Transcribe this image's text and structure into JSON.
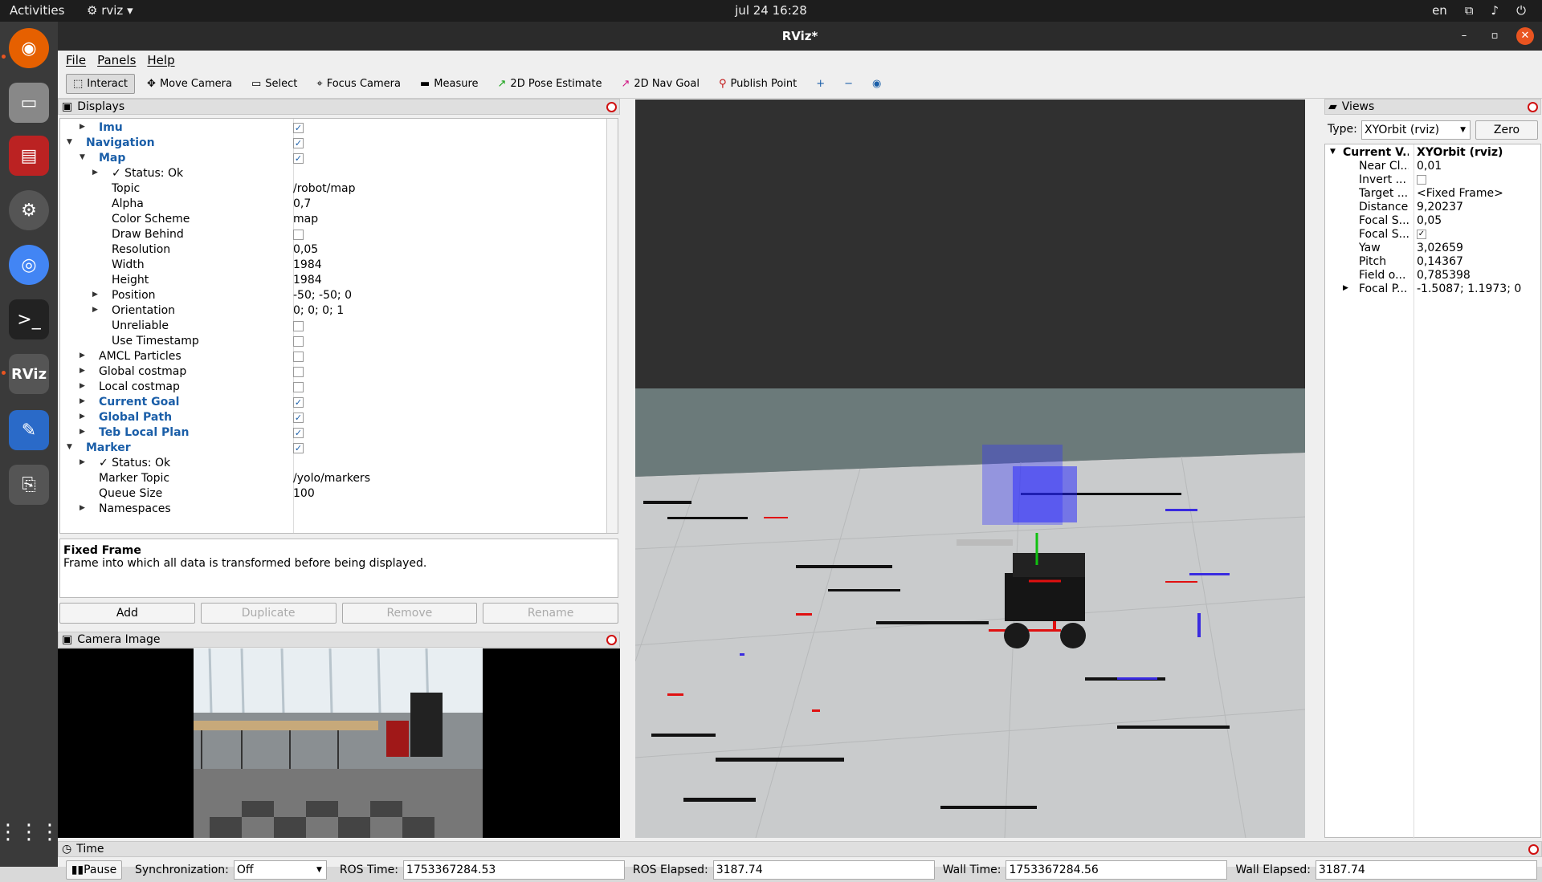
{
  "topbar": {
    "activities": "Activities",
    "app": "rviz",
    "clock": "jul 24  16:28",
    "lang": "en"
  },
  "window": {
    "title": "RViz*"
  },
  "menu": [
    "File",
    "Panels",
    "Help"
  ],
  "toolbar": [
    {
      "label": "Interact",
      "icon": "cursor-icon",
      "active": true
    },
    {
      "label": "Move Camera",
      "icon": "move-icon",
      "active": false
    },
    {
      "label": "Select",
      "icon": "select-icon",
      "active": false
    },
    {
      "label": "Focus Camera",
      "icon": "focus-icon",
      "active": false
    },
    {
      "label": "Measure",
      "icon": "ruler-icon",
      "active": false
    },
    {
      "label": "2D Pose Estimate",
      "icon": "green-arrow-icon",
      "active": false
    },
    {
      "label": "2D Nav Goal",
      "icon": "pink-arrow-icon",
      "active": false
    },
    {
      "label": "Publish Point",
      "icon": "pin-icon",
      "active": false
    }
  ],
  "displays": {
    "title": "Displays",
    "rows": [
      {
        "name": "Imu",
        "indent": 1,
        "arrow": "right",
        "blue": true,
        "check": true
      },
      {
        "name": "Navigation",
        "indent": 0,
        "arrow": "down",
        "blue": true,
        "check": true
      },
      {
        "name": "Map",
        "indent": 1,
        "arrow": "down",
        "blue": true,
        "check": true
      },
      {
        "name": "✓ Status: Ok",
        "indent": 2,
        "arrow": "right"
      },
      {
        "name": "Topic",
        "indent": 2,
        "value": "/robot/map"
      },
      {
        "name": "Alpha",
        "indent": 2,
        "value": "0,7"
      },
      {
        "name": "Color Scheme",
        "indent": 2,
        "value": "map"
      },
      {
        "name": "Draw Behind",
        "indent": 2,
        "check": false
      },
      {
        "name": "Resolution",
        "indent": 2,
        "value": "0,05"
      },
      {
        "name": "Width",
        "indent": 2,
        "value": "1984"
      },
      {
        "name": "Height",
        "indent": 2,
        "value": "1984"
      },
      {
        "name": "Position",
        "indent": 2,
        "arrow": "right",
        "value": "-50; -50; 0"
      },
      {
        "name": "Orientation",
        "indent": 2,
        "arrow": "right",
        "value": "0; 0; 0; 1"
      },
      {
        "name": "Unreliable",
        "indent": 2,
        "check": false
      },
      {
        "name": "Use Timestamp",
        "indent": 2,
        "check": false
      },
      {
        "name": "AMCL Particles",
        "indent": 1,
        "arrow": "right",
        "check": false
      },
      {
        "name": "Global costmap",
        "indent": 1,
        "arrow": "right",
        "check": false
      },
      {
        "name": "Local costmap",
        "indent": 1,
        "arrow": "right",
        "check": false
      },
      {
        "name": "Current Goal",
        "indent": 1,
        "arrow": "right",
        "blue": true,
        "check": true
      },
      {
        "name": "Global Path",
        "indent": 1,
        "arrow": "right",
        "blue": true,
        "check": true
      },
      {
        "name": "Teb Local Plan",
        "indent": 1,
        "arrow": "right",
        "blue": true,
        "check": true
      },
      {
        "name": "Marker",
        "indent": 0,
        "arrow": "down",
        "blue": true,
        "check": true
      },
      {
        "name": "✓ Status: Ok",
        "indent": 1,
        "arrow": "right"
      },
      {
        "name": "Marker Topic",
        "indent": 1,
        "value": "/yolo/markers"
      },
      {
        "name": "Queue Size",
        "indent": 1,
        "value": "100"
      },
      {
        "name": "Namespaces",
        "indent": 1,
        "arrow": "right"
      }
    ]
  },
  "description": {
    "title": "Fixed Frame",
    "text": "Frame into which all data is transformed before being displayed."
  },
  "buttons": {
    "add": "Add",
    "duplicate": "Duplicate",
    "remove": "Remove",
    "rename": "Rename"
  },
  "camera": {
    "title": "Camera Image"
  },
  "views": {
    "title": "Views",
    "type_label": "Type:",
    "type_value": "XYOrbit (rviz)",
    "zero": "Zero",
    "rows": [
      {
        "k": "Current V...",
        "v": "XYOrbit (rviz)",
        "bold": true
      },
      {
        "k": "Near Cl...",
        "v": "0,01"
      },
      {
        "k": "Invert ...",
        "check": false
      },
      {
        "k": "Target ...",
        "v": "<Fixed Frame>"
      },
      {
        "k": "Distance",
        "v": "9,20237"
      },
      {
        "k": "Focal S...",
        "v": "0,05"
      },
      {
        "k": "Focal S...",
        "check": true
      },
      {
        "k": "Yaw",
        "v": "3,02659"
      },
      {
        "k": "Pitch",
        "v": "0,14367"
      },
      {
        "k": "Field o...",
        "v": "0,785398"
      },
      {
        "k": "Focal P...",
        "v": "-1.5087; 1.1973; 0",
        "arrow": true
      }
    ]
  },
  "time": {
    "title": "Time",
    "pause": "Pause",
    "sync_label": "Synchronization:",
    "sync_value": "Off",
    "ros_time_label": "ROS Time:",
    "ros_time": "1753367284.53",
    "ros_elapsed_label": "ROS Elapsed:",
    "ros_elapsed": "3187.74",
    "wall_time_label": "Wall Time:",
    "wall_time": "1753367284.56",
    "wall_elapsed_label": "Wall Elapsed:",
    "wall_elapsed": "3187.74"
  }
}
